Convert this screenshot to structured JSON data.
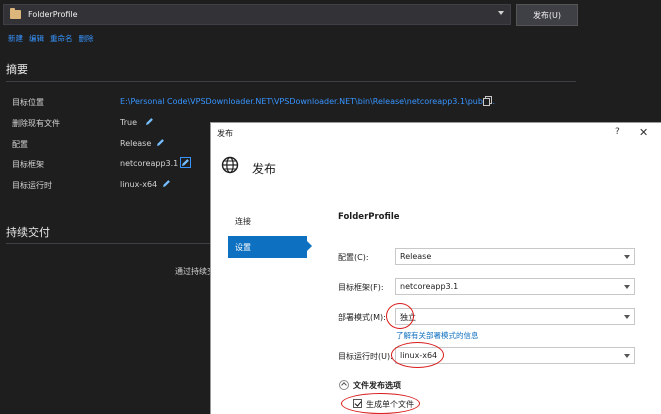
{
  "toolbar": {
    "profile_value": "FolderProfile",
    "publish_button": "发布(U)",
    "links": [
      "新建",
      "编辑",
      "重命名",
      "删除"
    ]
  },
  "summary": {
    "title": "摘要",
    "rows": [
      {
        "label": "目标位置",
        "value": "E:\\Personal Code\\VPSDownloader.NET\\VPSDownloader.NET\\bin\\Release\\netcoreapp3.1\\publi..."
      },
      {
        "label": "删除现有文件",
        "value": "True"
      },
      {
        "label": "配置",
        "value": "Release"
      },
      {
        "label": "目标框架",
        "value": "netcoreapp3.1"
      },
      {
        "label": "目标运行时",
        "value": "linux-x64"
      }
    ]
  },
  "cd": {
    "title": "持续交付",
    "text": "通过持续交"
  },
  "dialog": {
    "titlebar": "发布",
    "help": "?",
    "close": "✕",
    "header": "发布",
    "nav": [
      "连接",
      "设置"
    ],
    "profile_title": "FolderProfile",
    "fields": [
      {
        "label": "配置(C):",
        "value": "Release"
      },
      {
        "label": "目标框架(F):",
        "value": "netcoreapp3.1"
      },
      {
        "label": "部署模式(M):",
        "value": "独立"
      },
      {
        "label": "目标运行时(U):",
        "value": "linux-x64"
      }
    ],
    "learn_more": "了解有关部署模式的信息",
    "section": "文件发布选项",
    "checkbox_label": "生成单个文件",
    "checkbox_checked": true
  },
  "colors": {
    "accent": "#0e70c0",
    "link": "#3794ff",
    "highlight_oval": "#d81b1b"
  }
}
